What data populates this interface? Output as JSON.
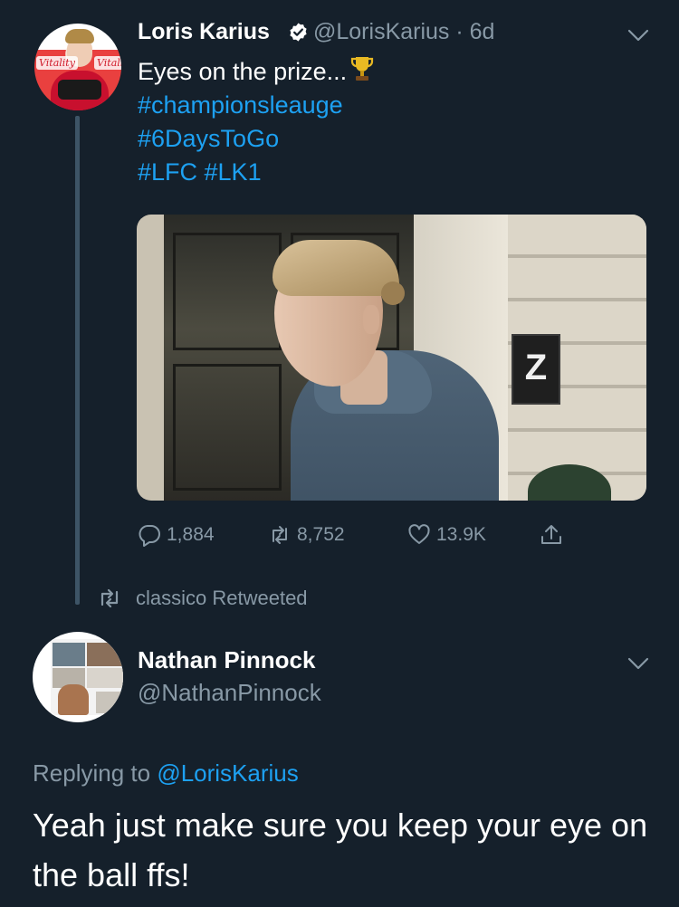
{
  "tweet": {
    "author_name": "Loris Karius",
    "handle_time": "@LorisKarius · 6d",
    "text_main": "Eyes on the prize...",
    "hashtag_line_1": "#championsleauge",
    "hashtag_line_2": "#6DaysToGo",
    "hashtag_line_3": "#LFC #LK1",
    "avatar_brand_left": "Vitality",
    "avatar_brand_right": "Vitali",
    "photo_sign": "Z",
    "replies": "1,884",
    "retweets": "8,752",
    "likes": "13.9K"
  },
  "retweet_notice": "classico Retweeted",
  "reply_tweet": {
    "author_name": "Nathan Pinnock",
    "handle": "@NathanPinnock",
    "replying_prefix": "Replying to ",
    "replying_mention": "@LorisKarius",
    "text": "Yeah just make sure you keep your eye on the ball ffs!"
  },
  "colors": {
    "background": "#15202b",
    "accent": "#1da1f2",
    "secondary_text": "#8899a6"
  },
  "icons": [
    "verified-badge-icon",
    "trophy-icon",
    "chevron-down-icon",
    "reply-icon",
    "retweet-icon",
    "like-icon",
    "share-icon"
  ]
}
